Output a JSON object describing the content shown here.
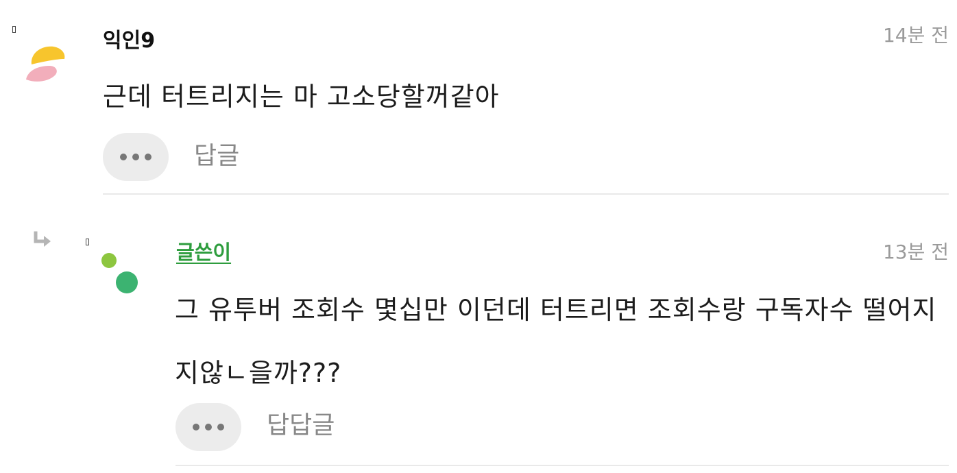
{
  "comments": [
    {
      "author": "익인9",
      "time": "14분 전",
      "text": "근데 터트리지는 마 고소당할꺼같아",
      "reply_label": "답글",
      "avatar_colors": [
        "#f7c52d",
        "#f2aebb"
      ]
    },
    {
      "author": "글쓴이",
      "author_color": "#2e9d3e",
      "time": "13분 전",
      "text": "그 유투버 조회수 몇십만 이던데 터트리면 조회수랑 구독자수 떨어지지않ㄴ을까???",
      "reply_label": "답답글",
      "avatar_colors": [
        "#8dc63f",
        "#3cb371"
      ]
    }
  ],
  "icons": {
    "more": "more-dots-icon",
    "reply_arrow": "reply-arrow-icon"
  }
}
